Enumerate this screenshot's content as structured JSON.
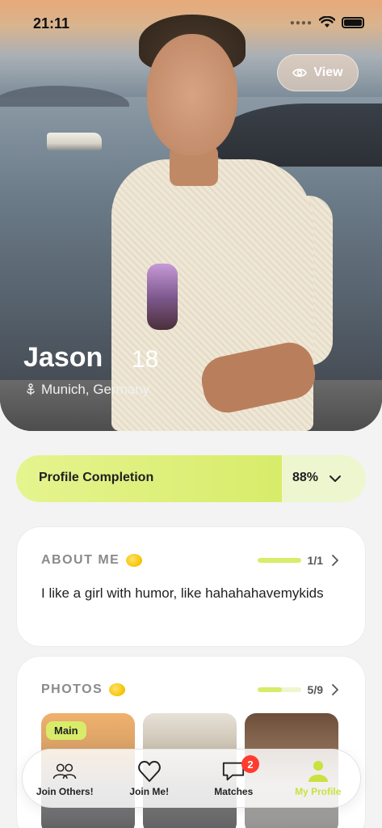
{
  "status_bar": {
    "time": "21:11"
  },
  "profile": {
    "view_label": "View",
    "name": "Jason",
    "age": "18",
    "location": "Munich, Germany"
  },
  "completion": {
    "label": "Profile Completion",
    "percent_text": "88%",
    "percent": 0.88
  },
  "about": {
    "title": "ABOUT ME",
    "progress_text": "1/1",
    "progress": 1.0,
    "text": "I like a girl with humor, like hahahahavemykids"
  },
  "photos": {
    "title": "PHOTOS",
    "progress_text": "5/9",
    "progress": 0.556,
    "main_badge": "Main"
  },
  "tabs": [
    {
      "label": "Join Others!",
      "icon": "people-icon",
      "active": false
    },
    {
      "label": "Join Me!",
      "icon": "heart-icon",
      "active": false
    },
    {
      "label": "Matches",
      "icon": "chat-bubble-icon",
      "active": false,
      "badge": "2"
    },
    {
      "label": "My Profile",
      "icon": "person-icon",
      "active": true
    }
  ],
  "colors": {
    "accent": "#d8ec6a",
    "badge": "#ff3b30"
  }
}
